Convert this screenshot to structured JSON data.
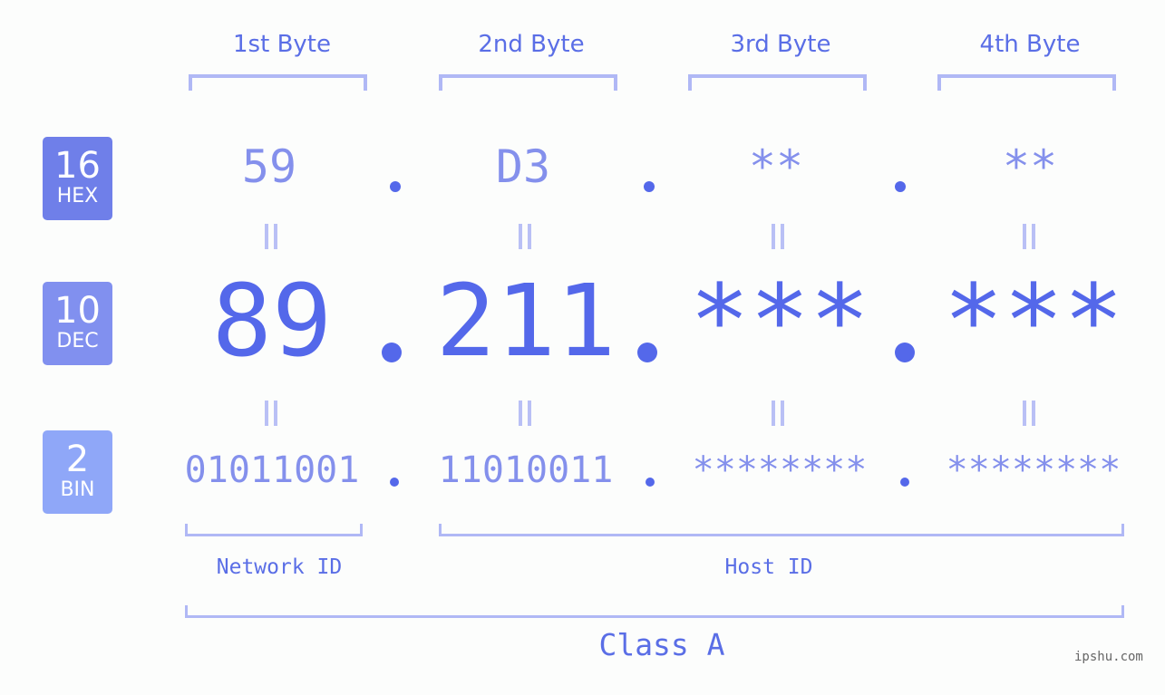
{
  "colors": {
    "hex_badge": "#6f7fe9",
    "dec_badge": "#8190ef",
    "bin_badge": "#8fa7f8",
    "accent": "#5468ea",
    "light_value": "#8490ec",
    "bracket": "#b0b8f5"
  },
  "byte_headers": [
    "1st Byte",
    "2nd Byte",
    "3rd Byte",
    "4th Byte"
  ],
  "rows": {
    "hex": {
      "base": "16",
      "label": "HEX",
      "values": [
        "59",
        "D3",
        "**",
        "**"
      ]
    },
    "dec": {
      "base": "10",
      "label": "DEC",
      "values": [
        "89",
        "211",
        "***",
        "***"
      ]
    },
    "bin": {
      "base": "2",
      "label": "BIN",
      "values": [
        "01011001",
        "11010011",
        "********",
        "********"
      ]
    }
  },
  "separator": ".",
  "sections": {
    "network_id": "Network ID",
    "host_id": "Host ID",
    "class": "Class A"
  },
  "watermark": "ipshu.com"
}
